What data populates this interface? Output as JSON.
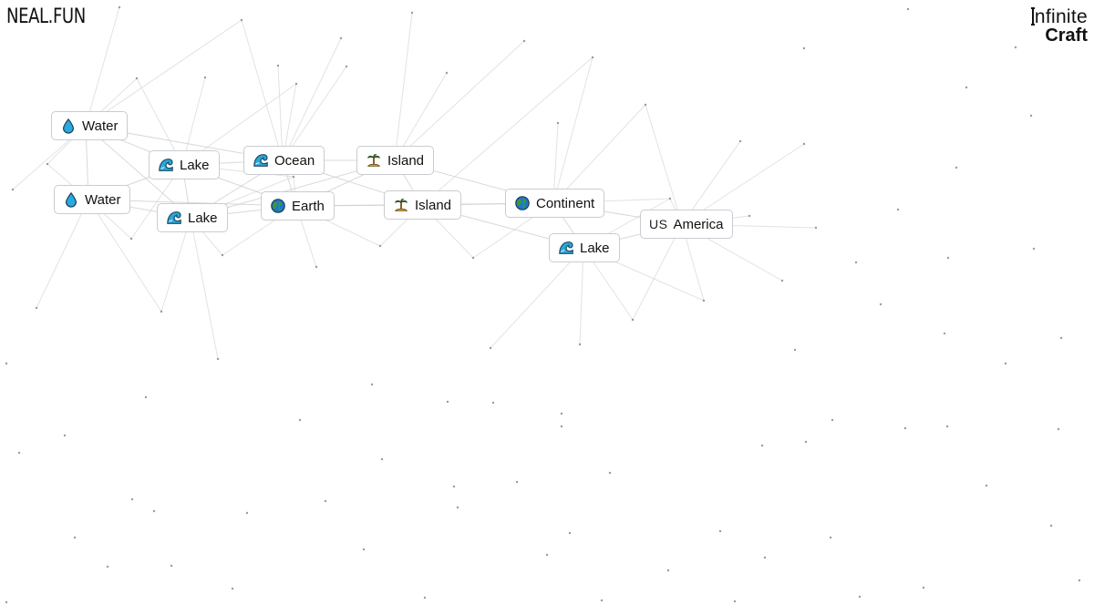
{
  "header": {
    "logo": "NEAL.FUN",
    "brand_line1": "nfinite",
    "brand_line2": "Craft"
  },
  "items": [
    {
      "label": "Water",
      "emoji": "water-drop-icon"
    },
    {
      "label": "Water",
      "emoji": "water-drop-icon"
    },
    {
      "label": "Lake",
      "emoji": "wave-icon"
    },
    {
      "label": "Lake",
      "emoji": "wave-icon"
    },
    {
      "label": "Ocean",
      "emoji": "wave-icon"
    },
    {
      "label": "Earth",
      "emoji": "globe-icon"
    },
    {
      "label": "Island",
      "emoji": "palm-island-icon"
    },
    {
      "label": "Island",
      "emoji": "palm-island-icon"
    },
    {
      "label": "Continent",
      "emoji": "globe-icon"
    },
    {
      "label": "Lake",
      "emoji": "wave-icon"
    },
    {
      "label": "America",
      "emoji": "us-flag-icon",
      "emoji_text": "US"
    }
  ],
  "colors": {
    "border": "#c8ccd2",
    "line": "#d9d9d9",
    "dot": "#8a8a8a",
    "water": "#29a9e0",
    "wave_dark": "#1c4a63",
    "globe_blue": "#1f77c9",
    "globe_green": "#3a9b32",
    "palm_green": "#4a8d2b",
    "sand": "#e6b032"
  }
}
